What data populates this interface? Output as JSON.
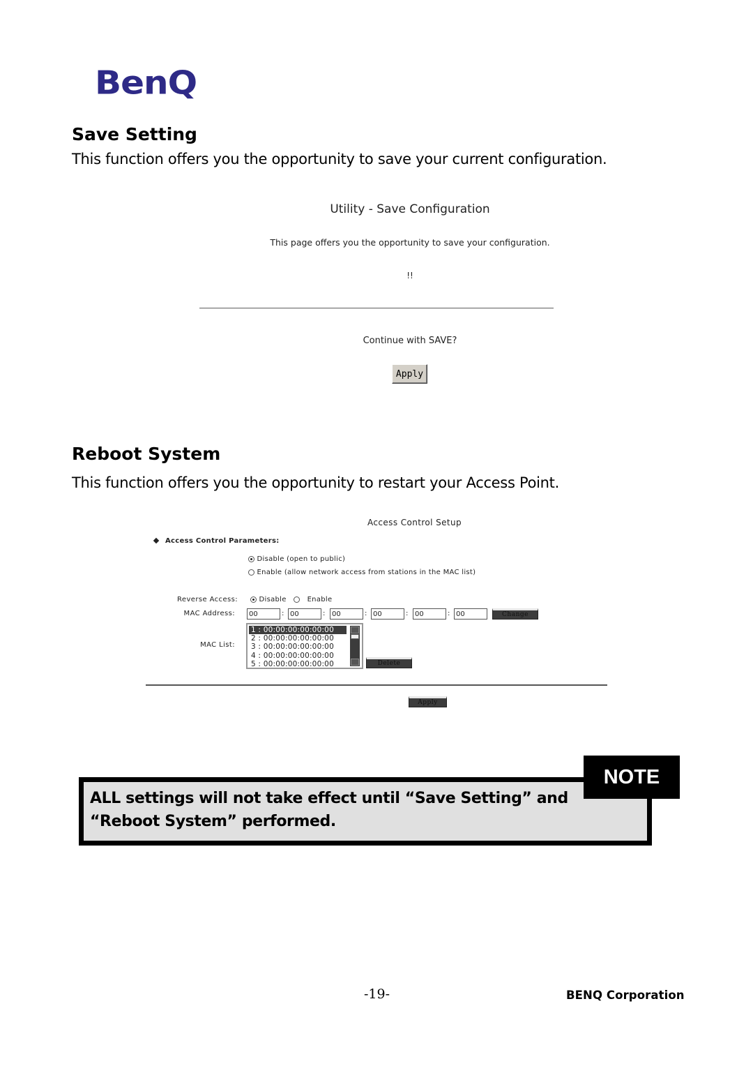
{
  "logo": {
    "text": "BenQ",
    "color": "#2e2a87"
  },
  "save_section": {
    "heading": "Save Setting",
    "description": "This function offers you the opportunity to save your current configuration."
  },
  "save_screenshot": {
    "title": "Utility - Save Configuration",
    "description": "This page offers you the opportunity to save your configuration.",
    "exclamation": "!!",
    "prompt": "Continue with SAVE?",
    "apply_label": "Apply"
  },
  "reboot_section": {
    "heading": "Reboot System",
    "description": "This function offers you the opportunity to restart your Access Point."
  },
  "access_screenshot": {
    "title": "Access Control Setup",
    "params_heading": "Access Control Parameters:",
    "options": [
      {
        "label": "Disable (open to public)",
        "checked": true
      },
      {
        "label": "Enable (allow network access from stations in the MAC list)",
        "checked": false
      }
    ],
    "reverse_access": {
      "label": "Reverse Access:",
      "options": [
        {
          "label": "Disable",
          "checked": true
        },
        {
          "label": "Enable",
          "checked": false
        }
      ]
    },
    "mac_address": {
      "label": "MAC Address:",
      "fields": [
        "00",
        "00",
        "00",
        "00",
        "00",
        "00"
      ],
      "separator": ":",
      "change_label": "Change"
    },
    "mac_list": {
      "label": "MAC List:",
      "items": [
        "1 : 00:00:00:00:00:00",
        "2 : 00:00:00:00:00:00",
        "3 : 00:00:00:00:00:00",
        "4 : 00:00:00:00:00:00",
        "5 : 00:00:00:00:00:00"
      ],
      "selected_index": 0,
      "delete_label": "Delete"
    },
    "apply_label": "Apply"
  },
  "note": {
    "tag": "NOTE",
    "text_line1": "ALL settings will not take effect until “Save Setting” and",
    "text_line2": "“Reboot System” performed."
  },
  "footer": {
    "page_number": "-19-",
    "company": "BENQ Corporation"
  }
}
